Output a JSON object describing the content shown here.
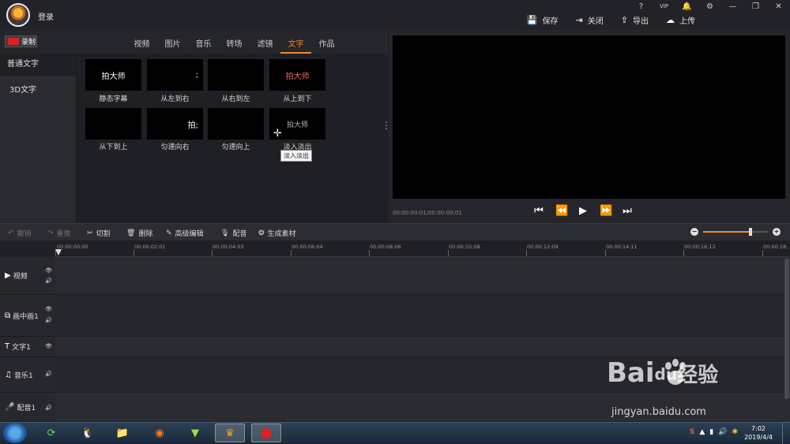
{
  "titlebar": {
    "login": "登录",
    "sys_icons": [
      "?",
      "VIP",
      "🔔",
      "⚙",
      "—",
      "❐",
      "✕"
    ],
    "actions": [
      {
        "icon": "save-icon",
        "glyph": "💾",
        "label": "保存"
      },
      {
        "icon": "close-doc-icon",
        "glyph": "⇥",
        "label": "关闭"
      },
      {
        "icon": "export-icon",
        "glyph": "⇪",
        "label": "导出"
      },
      {
        "icon": "upload-icon",
        "glyph": "☁",
        "label": "上传"
      }
    ]
  },
  "library": {
    "record_label": "录制",
    "tabs": [
      "视频",
      "图片",
      "音乐",
      "转场",
      "滤镜",
      "文字",
      "作品"
    ],
    "active_tab": "文字",
    "categories": [
      "普通文字",
      "3D文字"
    ],
    "items": [
      {
        "thumb_text": "拍大师",
        "label": "静态字幕"
      },
      {
        "thumb_text": ";",
        "label": "从左到右"
      },
      {
        "thumb_text": "",
        "label": "从右到左"
      },
      {
        "thumb_text": "拍大师",
        "label": "从上到下"
      },
      {
        "thumb_text": "",
        "label": "从下到上"
      },
      {
        "thumb_text": "拍;",
        "label": "匀速向右"
      },
      {
        "thumb_text": "",
        "label": "匀速向上"
      },
      {
        "thumb_text": "拍大师",
        "label": "淡入淡出"
      }
    ],
    "tooltip": "淡入淡出"
  },
  "preview": {
    "timecode": "00:00:00:01/00:00:00:01",
    "controls": [
      "⏮",
      "⏪",
      "▶",
      "⏩",
      "⏭"
    ]
  },
  "toolbar": {
    "undo": "撤销",
    "redo": "重做",
    "cut": "切割",
    "delete": "删除",
    "advanced_edit": "高级编辑",
    "dub": "配音",
    "generate": "生成素材",
    "zoom_minus": "−",
    "zoom_plus": "+",
    "zoom_level": 0.73
  },
  "timeline": {
    "ticks": [
      "00:00:00:00",
      "00:00:02:01",
      "00:00:04:03",
      "00:00:06:04",
      "00:00:08:06",
      "00:00:10:08",
      "00:00:12:09",
      "00:00:14:11",
      "00:00:16:12",
      "00:00:18:"
    ],
    "tracks": [
      {
        "icon": "video-track-icon",
        "glyph": "▶",
        "label": "视频"
      },
      {
        "icon": "pip-track-icon",
        "glyph": "⧉",
        "label": "画中画1"
      },
      {
        "icon": "text-track-icon",
        "glyph": "T",
        "label": "文字1"
      },
      {
        "icon": "music-track-icon",
        "glyph": "♫",
        "label": "音乐1"
      },
      {
        "icon": "dub-track-icon",
        "glyph": "🎤",
        "label": "配音1"
      }
    ]
  },
  "watermark": {
    "logo_left": "Bai",
    "logo_right": "经验",
    "logo_du": "du",
    "url": "jingyan.baidu.com"
  },
  "taskbar": {
    "time": "7:02",
    "date": "2019/4/4",
    "tray": [
      "S",
      "▲",
      "▮",
      "🔊",
      "✱"
    ]
  }
}
